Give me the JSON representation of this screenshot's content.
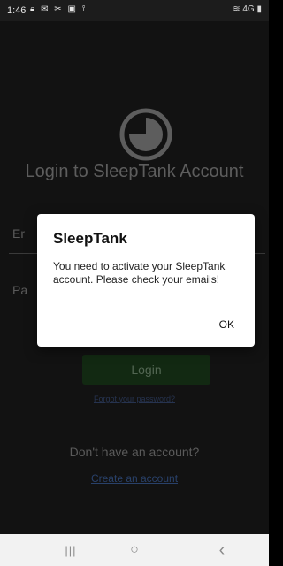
{
  "status_bar": {
    "time": "1:46",
    "left_icons": [
      "lock-icon",
      "mail-icon",
      "tools-icon",
      "image-icon",
      "signal-antenna-icon"
    ],
    "right_icons": [
      "wifi-icon",
      "network-icon",
      "battery-icon"
    ],
    "network_text": "4G"
  },
  "title": "Login to SleepTank Account",
  "fields": {
    "email_label": "Er",
    "password_label": "Pa"
  },
  "login_button": "Login",
  "forgot_password": "Forgot your password?",
  "no_account_text": "Don't have an account?",
  "create_account": "Create an account",
  "dialog": {
    "title": "SleepTank",
    "message": "You need to activate your SleepTank account. Please check your emails!",
    "ok": "OK"
  },
  "nav": {
    "recents": "|||",
    "home": "○",
    "back": "‹"
  }
}
